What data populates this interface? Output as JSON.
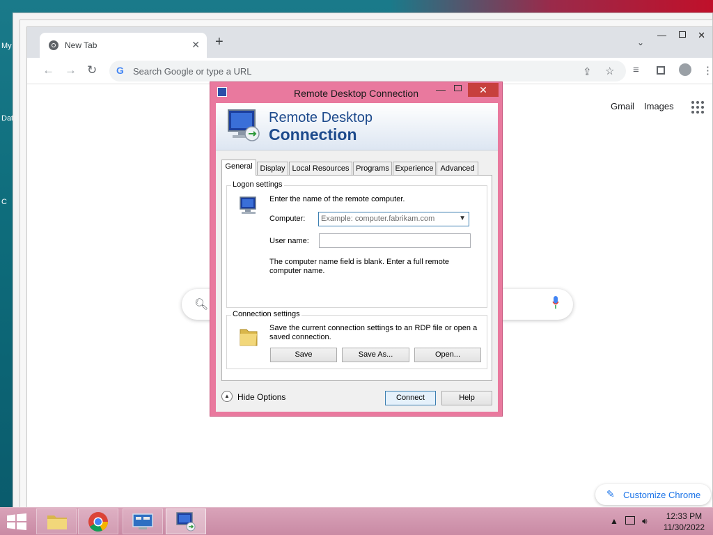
{
  "desktop": {
    "label_1": "My",
    "label_2": "Dat",
    "label_3": "C"
  },
  "chrome": {
    "tab_title": "New Tab",
    "tab_close": "✕",
    "new_tab": "+",
    "tab_search": "⌄",
    "omnibox_placeholder": "Search Google or type a URL",
    "links": {
      "gmail": "Gmail",
      "images": "Images"
    },
    "customize_label": "Customize Chrome"
  },
  "rdp": {
    "title": "Remote Desktop Connection",
    "close": "✕",
    "banner_line1": "Remote Desktop",
    "banner_line2": "Connection",
    "tabs": [
      "General",
      "Display",
      "Local Resources",
      "Programs",
      "Experience",
      "Advanced"
    ],
    "active_tab": "General",
    "logon": {
      "group_label": "Logon settings",
      "instruction": "Enter the name of the remote computer.",
      "computer_label": "Computer:",
      "computer_placeholder": "Example: computer.fabrikam.com",
      "username_label": "User name:",
      "username_value": "",
      "blank_msg": "The computer name field is blank. Enter a full remote computer name."
    },
    "connection": {
      "group_label": "Connection settings",
      "description": "Save the current connection settings to an RDP file or open a saved connection.",
      "save": "Save",
      "save_as": "Save As...",
      "open": "Open..."
    },
    "hide_options": "Hide Options",
    "connect": "Connect",
    "help": "Help"
  },
  "taskbar": {
    "time": "12:33 PM",
    "date": "11/30/2022"
  },
  "colors": {
    "titlebar_accent": "#e9799e",
    "close_red": "#c7403d",
    "banner_text": "#1d4a8c",
    "chrome_link": "#1a73e8"
  }
}
